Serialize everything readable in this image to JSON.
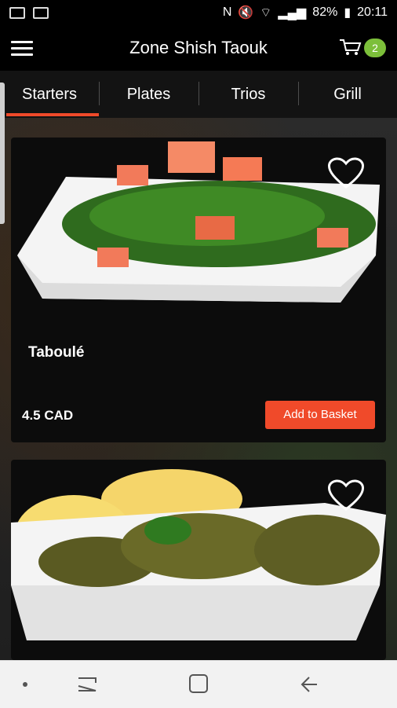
{
  "status": {
    "battery": "82%",
    "time": "20:11"
  },
  "app": {
    "title": "Zone Shish Taouk",
    "cart_count": "2"
  },
  "tabs": [
    {
      "label": "Starters",
      "active": true
    },
    {
      "label": "Plates",
      "active": false
    },
    {
      "label": "Trios",
      "active": false
    },
    {
      "label": "Grill",
      "active": false
    }
  ],
  "items": [
    {
      "name": "Taboulé",
      "price": "4.5 CAD",
      "button": "Add to Basket"
    },
    {
      "name": "",
      "price": "",
      "button": ""
    }
  ],
  "colors": {
    "accent": "#f04a2a",
    "badge": "#7cbf3a",
    "appbar": "#000000"
  }
}
